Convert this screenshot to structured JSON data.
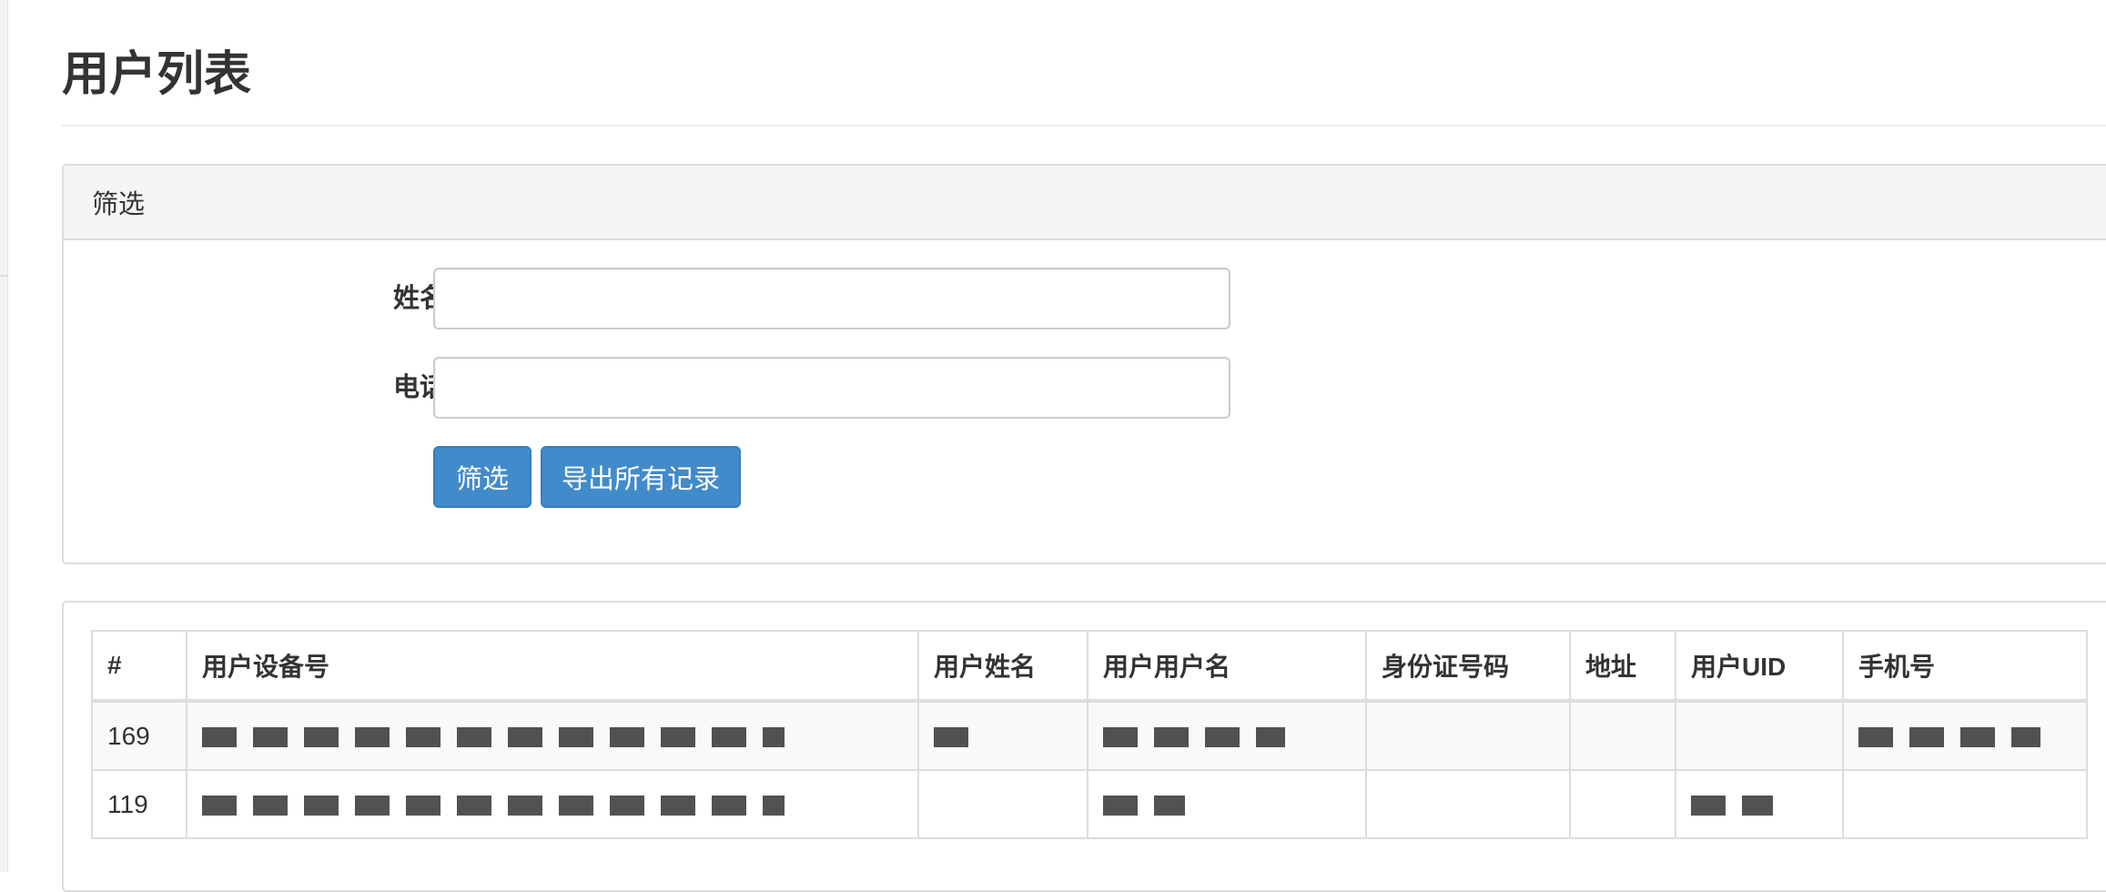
{
  "page": {
    "title": "用户列表"
  },
  "filter": {
    "heading": "筛选",
    "name_label": "姓名",
    "name_value": "",
    "phone_label": "电话",
    "phone_value": "",
    "filter_button": "筛选",
    "export_button": "导出所有记录"
  },
  "table": {
    "headers": [
      "#",
      "用户设备号",
      "用户姓名",
      "用户用户名",
      "身份证号码",
      "地址",
      "用户UID",
      "手机号"
    ],
    "rows": [
      {
        "id": "169"
      },
      {
        "id": "119"
      }
    ]
  },
  "colors": {
    "primary": "#428bca",
    "primary_border": "#357ebd",
    "panel_heading_bg": "#f5f5f5",
    "border": "#dddddd",
    "text": "#333333"
  }
}
